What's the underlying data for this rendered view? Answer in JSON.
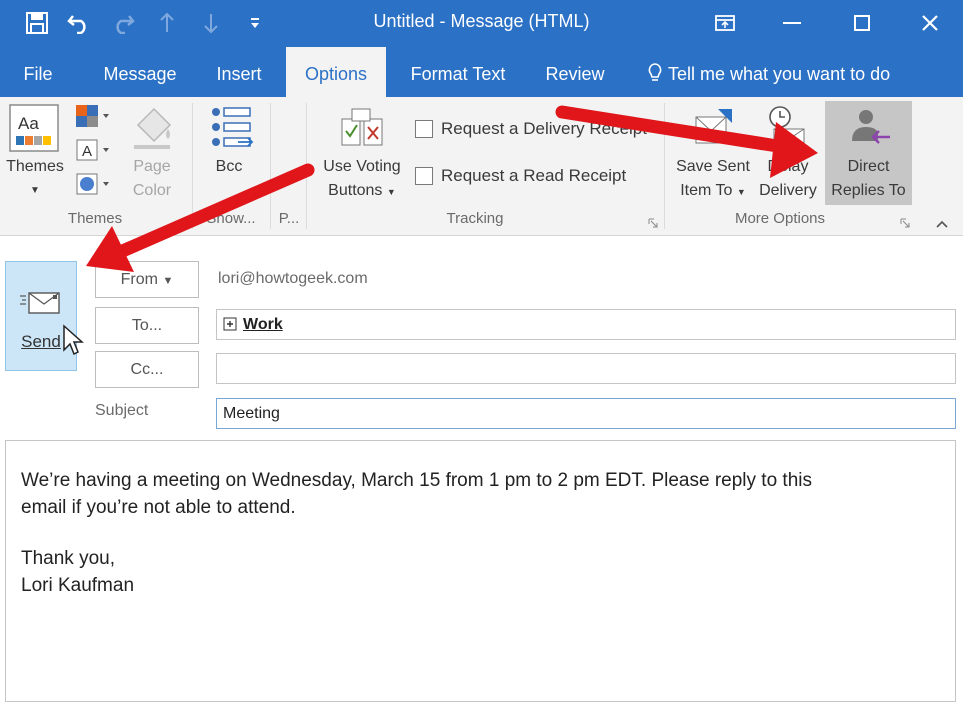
{
  "window": {
    "title": "Untitled  -  Message (HTML)",
    "qat_icons": [
      "save-icon",
      "undo-icon",
      "redo-icon",
      "up-arrow-icon",
      "down-arrow-icon",
      "customize-qat-icon"
    ],
    "controls": [
      "ribbon-display-options-icon",
      "minimize-icon",
      "maximize-icon",
      "close-icon"
    ]
  },
  "tabs": [
    {
      "label": "File"
    },
    {
      "label": "Message"
    },
    {
      "label": "Insert"
    },
    {
      "label": "Options",
      "active": true
    },
    {
      "label": "Format Text"
    },
    {
      "label": "Review"
    }
  ],
  "tell_me": "Tell me what you want to do",
  "ribbon": {
    "themes_line1": "Themes",
    "page_color_line1": "Page",
    "page_color_line2": "Color",
    "bcc": "Bcc",
    "voting_line1": "Use Voting",
    "voting_line2": "Buttons",
    "delivery_receipt": "Request a Delivery Receipt",
    "read_receipt": "Request a Read Receipt",
    "save_sent_line1": "Save Sent",
    "save_sent_line2": "Item To",
    "delay_line1": "Delay",
    "delay_line2": "Delivery",
    "direct_line1": "Direct",
    "direct_line2": "Replies To",
    "groups": {
      "themes": "Themes",
      "show": "Show...",
      "p": "P...",
      "tracking": "Tracking",
      "more_options": "More Options"
    }
  },
  "compose": {
    "send": "Send",
    "from_btn": "From",
    "from_value": "lori@howtogeek.com",
    "to_btn": "To...",
    "to_value": "Work",
    "cc_btn": "Cc...",
    "cc_value": "",
    "subject_label": "Subject",
    "subject_value": "Meeting"
  },
  "body": {
    "line1": "We’re having a meeting on Wednesday, March 15 from 1 pm to 2 pm EDT. Please reply to this",
    "line2": "email if you’re not able to attend.",
    "line3": "Thank you,",
    "line4": "Lori Kaufman"
  },
  "colors": {
    "accent": "#2b71c6",
    "annotation_arrow": "#e0161b",
    "send_highlight": "#cde6f7"
  }
}
